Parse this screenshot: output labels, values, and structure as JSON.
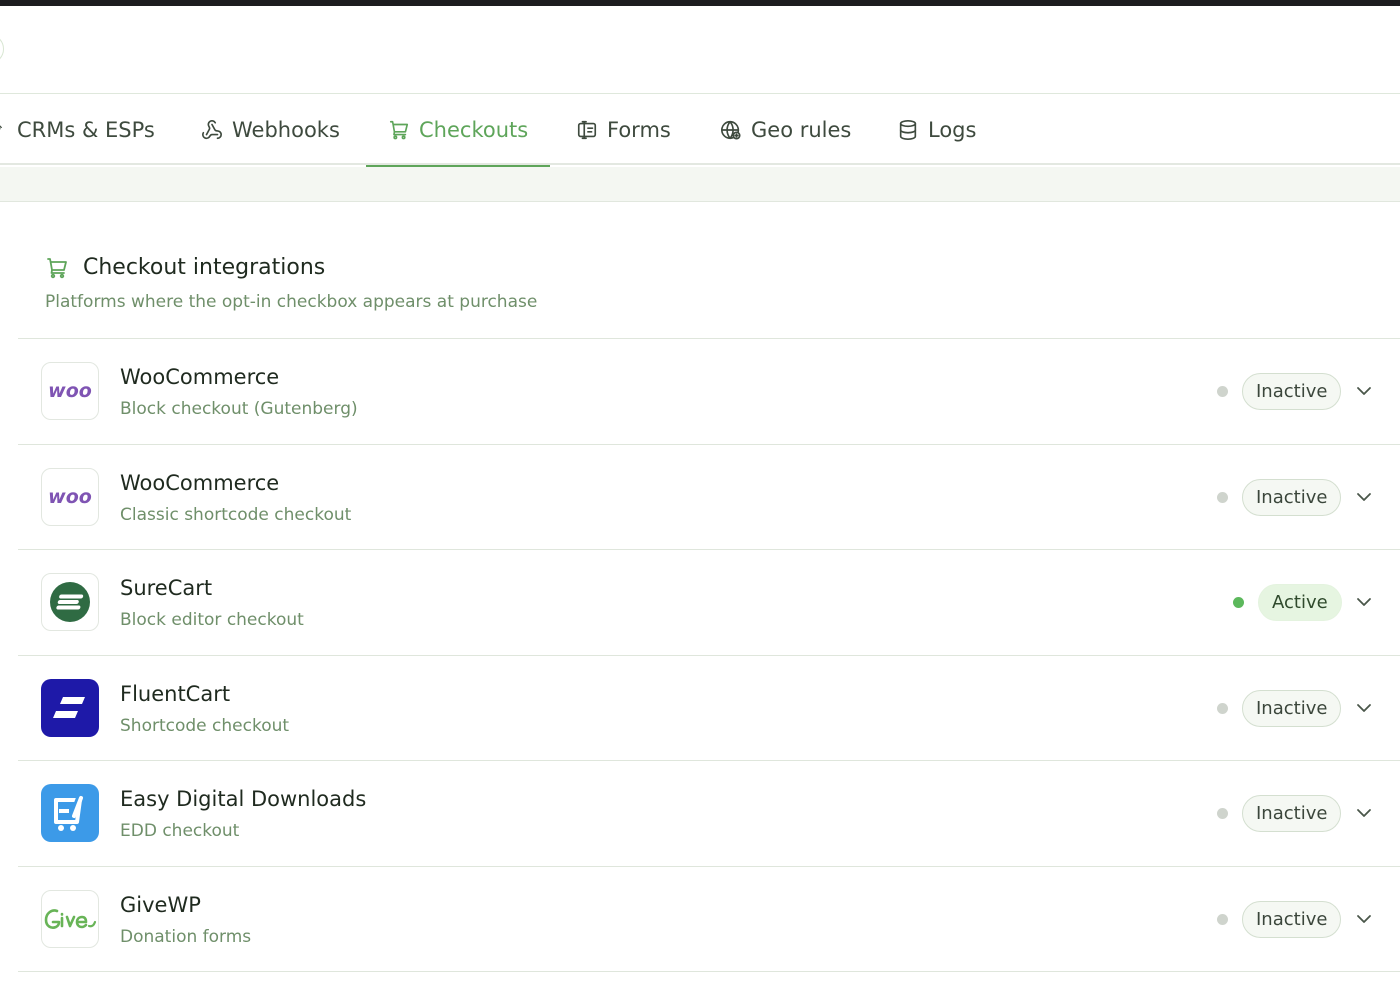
{
  "tabs": [
    {
      "id": "crms",
      "label": "CRMs & ESPs",
      "icon": "link-icon",
      "active": false
    },
    {
      "id": "webhooks",
      "label": "Webhooks",
      "icon": "webhook-icon",
      "active": false
    },
    {
      "id": "checkouts",
      "label": "Checkouts",
      "icon": "cart-icon",
      "active": true
    },
    {
      "id": "forms",
      "label": "Forms",
      "icon": "form-icon",
      "active": false
    },
    {
      "id": "geo",
      "label": "Geo rules",
      "icon": "globe-icon",
      "active": false
    },
    {
      "id": "logs",
      "label": "Logs",
      "icon": "database-icon",
      "active": false
    }
  ],
  "section": {
    "title": "Checkout integrations",
    "subtitle": "Platforms where the opt-in checkbox appears at purchase",
    "icon": "cart-icon"
  },
  "integrations": [
    {
      "name": "WooCommerce",
      "description": "Block checkout (Gutenberg)",
      "status": "Inactive",
      "logo": "woo-logo"
    },
    {
      "name": "WooCommerce",
      "description": "Classic shortcode checkout",
      "status": "Inactive",
      "logo": "woo-logo"
    },
    {
      "name": "SureCart",
      "description": "Block editor checkout",
      "status": "Active",
      "logo": "surecart-logo"
    },
    {
      "name": "FluentCart",
      "description": "Shortcode checkout",
      "status": "Inactive",
      "logo": "fluentcart-logo"
    },
    {
      "name": "Easy Digital Downloads",
      "description": "EDD checkout",
      "status": "Inactive",
      "logo": "edd-logo"
    },
    {
      "name": "GiveWP",
      "description": "Donation forms",
      "status": "Inactive",
      "logo": "givewp-logo"
    }
  ],
  "colors": {
    "accent": "#5ea55a",
    "muted_text": "#6f8f6a",
    "active_dot": "#5cb85c",
    "inactive_dot": "#cfd4cd",
    "woo_purple": "#7f54b3",
    "surecart_green": "#2f6b43",
    "fluentcart_blue": "#1e19a8",
    "edd_blue": "#3c9ae8",
    "give_green": "#68b457"
  }
}
